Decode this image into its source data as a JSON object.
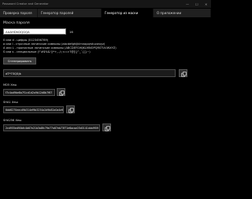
{
  "window": {
    "title": "Password Creator and Generator",
    "controls": {
      "minimize": "—",
      "maximize": "☐",
      "close": "✕"
    }
  },
  "tabs": [
    {
      "label": "Проверка пароля",
      "active": false
    },
    {
      "label": "Генератор паролей",
      "active": false
    },
    {
      "label": "Генератор из маски",
      "active": true
    },
    {
      "label": "О приложении",
      "active": false
    }
  ],
  "mask": {
    "label": "Маска пароля",
    "value": "AAAHDhDQGQA",
    "length": "16",
    "legend": [
      "0 или d - цифры (0123456789)",
      "a или l - строчные латинские символы (abcdefghijklmnopqrstuvwxyz)",
      "A или L - прописные латинские символы (ABCDEFGHIJKLMNOPQRSTUVWXYZ)",
      "S или s - специальные (!\"#$%&'()*+,-./:;<=>?@[\\]^_`{|}~)"
    ]
  },
  "generate_button": "Сгенерировать",
  "result": {
    "value": "dT*?3Q5Jk"
  },
  "hashes": [
    {
      "label": "MD5 Хеш",
      "value": "f7c4ad9be8a7f1cd1d2a9b12d8b7f67"
    },
    {
      "label": "SHA1 Хеш",
      "value": "6dd6270eecd9b314ef9b3234a2d9b82a0a4e9f"
    },
    {
      "label": "SHA256 Хеш",
      "value": "2cd955ed90bfc4b67e21b3a8fc79e77a67eb73f71e6acac03d0141dda9f09"
    }
  ]
}
